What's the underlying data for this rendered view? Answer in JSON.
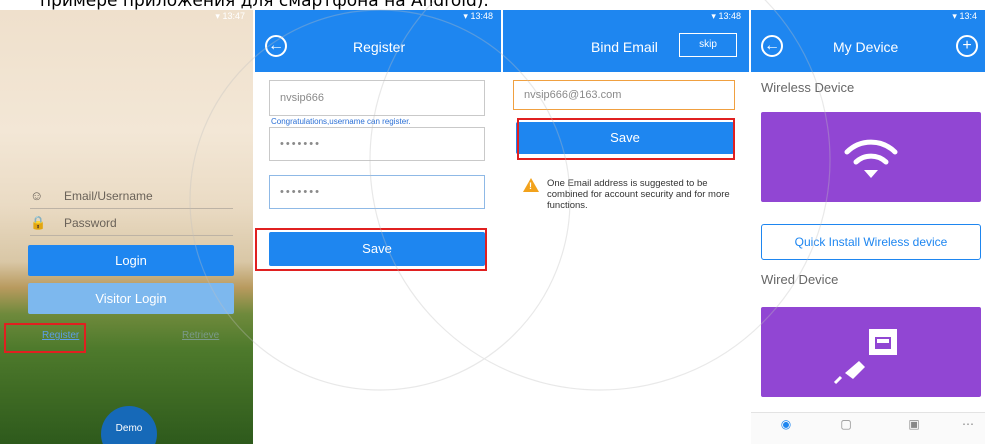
{
  "caption": "примере приложения для смартфона на Android).",
  "screen1": {
    "status_time": "13:47",
    "email_placeholder": "Email/Username",
    "password_placeholder": "Password",
    "login_label": "Login",
    "visitor_login_label": "Visitor Login",
    "register_link": "Register",
    "forgot_link": "Retrieve",
    "demo_label": "Demo"
  },
  "screen2": {
    "status_time": "13:48",
    "title": "Register",
    "username_value": "nvsip666",
    "username_hint": "Congratulations,username can register.",
    "password_mask": "•••••••",
    "confirm_mask": "•••••••",
    "save_label": "Save"
  },
  "screen3": {
    "status_time": "13:48",
    "title": "Bind Email",
    "skip_label": "skip",
    "email_value": "nvsip666@163.com",
    "save_label": "Save",
    "warning_text": "One Email address is suggested to be combined for account security and for more functions."
  },
  "screen4": {
    "status_time": "13:4",
    "title": "My Device",
    "wireless_label": "Wireless Device",
    "quick_install_label": "Quick Install Wireless device",
    "wired_label": "Wired Device",
    "tabs": [
      "camera-icon",
      "message-icon",
      "cloud-icon",
      "more-icon"
    ]
  },
  "colors": {
    "accent": "#1e86f0",
    "card": "#9146d3",
    "highlight": "#e02020",
    "warning": "#f2a21c"
  }
}
